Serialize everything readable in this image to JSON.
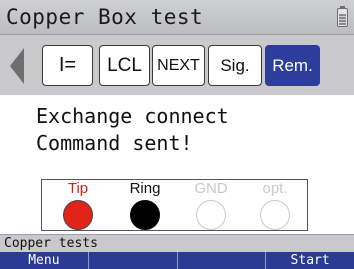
{
  "window": {
    "title": "Copper Box test",
    "battery_icon": "battery-icon"
  },
  "toolbar": {
    "scroll_left_icon": "triangle-left-icon",
    "buttons": [
      {
        "label": "I=",
        "selected": false
      },
      {
        "label": "LCL",
        "selected": false
      },
      {
        "label": "NEXT",
        "selected": false
      },
      {
        "label": "Sig.",
        "selected": false
      },
      {
        "label": "Rem.",
        "selected": true
      }
    ],
    "selected_color": "#2c3d9a"
  },
  "message": {
    "line1": "Exchange connect",
    "line2": "Command sent!"
  },
  "wires": [
    {
      "label": "Tip",
      "color": "#e22319",
      "state": "active"
    },
    {
      "label": "Ring",
      "color": "#000000",
      "state": "active"
    },
    {
      "label": "GND",
      "color": "#c9c9c9",
      "state": "inactive"
    },
    {
      "label": "opt.",
      "color": "#c9c9c9",
      "state": "inactive"
    }
  ],
  "status": {
    "text": "Copper tests"
  },
  "softkeys": [
    {
      "label": "Menu"
    },
    {
      "label": ""
    },
    {
      "label": ""
    },
    {
      "label": "Start"
    }
  ],
  "colors": {
    "softkey_bar": "#2b3b93",
    "title_bar": "#c9c9cc"
  }
}
